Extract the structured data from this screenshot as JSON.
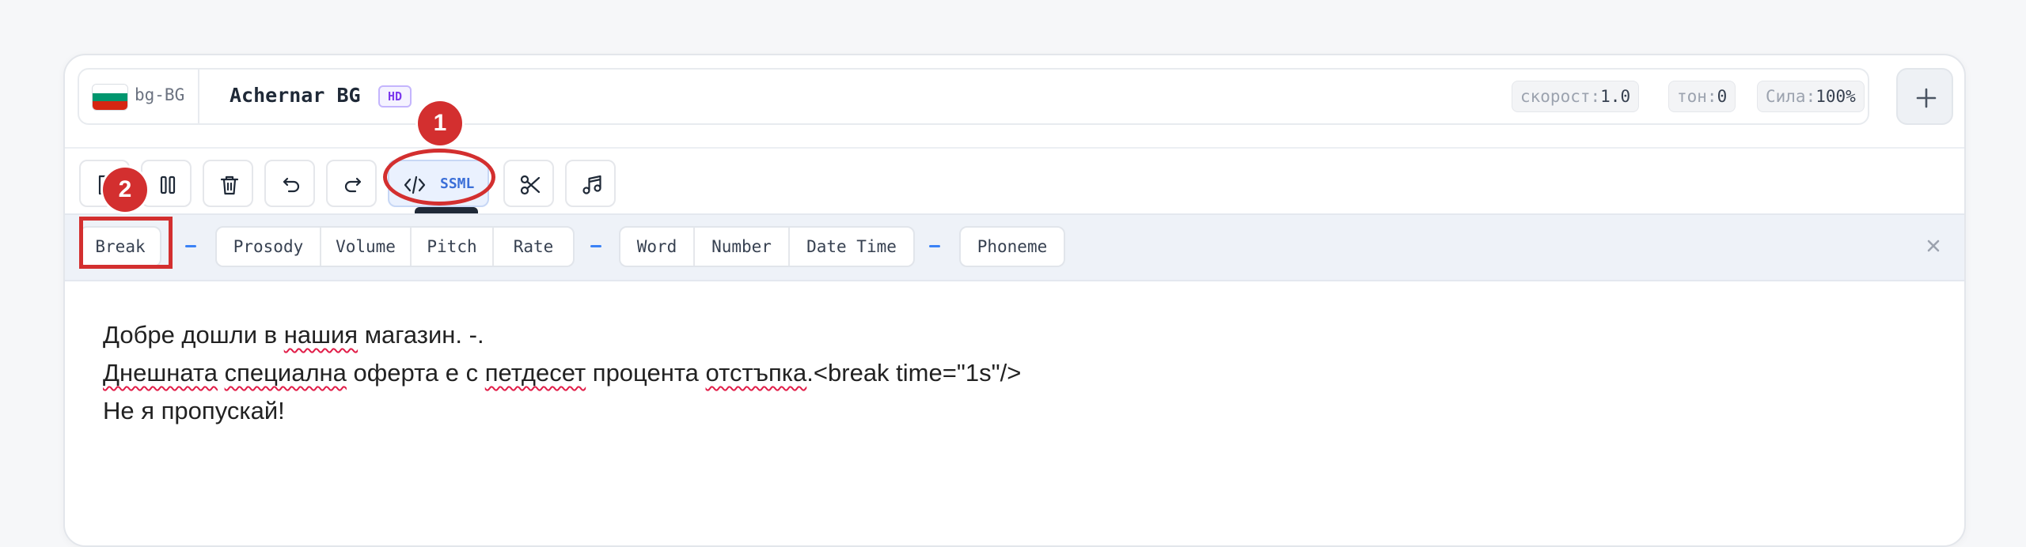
{
  "voice": {
    "language_code": "bg-BG",
    "flag_colors": [
      "#ffffff",
      "#00966e",
      "#d62612"
    ],
    "name": "Achernar BG",
    "quality_badge": "HD",
    "params": [
      {
        "label": "скорост:",
        "value": "1.0"
      },
      {
        "label": "тон:",
        "value": "0"
      },
      {
        "label": "Сила:",
        "value": "100%"
      }
    ],
    "add_icon": "plus-icon"
  },
  "toolbar": {
    "buttons": [
      "upload-icon",
      "pause-icon",
      "trash-icon",
      "undo-icon",
      "redo-icon",
      "code-icon",
      "scissors-icon",
      "music-note-icon"
    ],
    "ssml_label": "SSML"
  },
  "ssml_tags": {
    "groups": [
      [
        "Break"
      ],
      [
        "Prosody",
        "Volume",
        "Pitch",
        "Rate"
      ],
      [
        "Word",
        "Number",
        "Date Time"
      ],
      [
        "Phoneme"
      ]
    ],
    "close_icon": "close-icon"
  },
  "editor": {
    "lines": [
      [
        {
          "text": "Добре дошли в ",
          "error": false
        },
        {
          "text": "нашия",
          "error": true
        },
        {
          "text": " магазин. -.",
          "error": false
        }
      ],
      [
        {
          "text": "Днешната",
          "error": true
        },
        {
          "text": " ",
          "error": false
        },
        {
          "text": "специална",
          "error": true
        },
        {
          "text": " оферта е с ",
          "error": false
        },
        {
          "text": "петдесет",
          "error": true
        },
        {
          "text": " процента ",
          "error": false
        },
        {
          "text": "отстъпка",
          "error": true
        },
        {
          "text": ".<break time=\"1s\"/>",
          "error": false
        }
      ],
      [
        {
          "text": "Не я пропускай!",
          "error": false
        }
      ]
    ]
  },
  "annotations": {
    "badges": [
      "1",
      "2"
    ],
    "color": "#d32f2f"
  }
}
